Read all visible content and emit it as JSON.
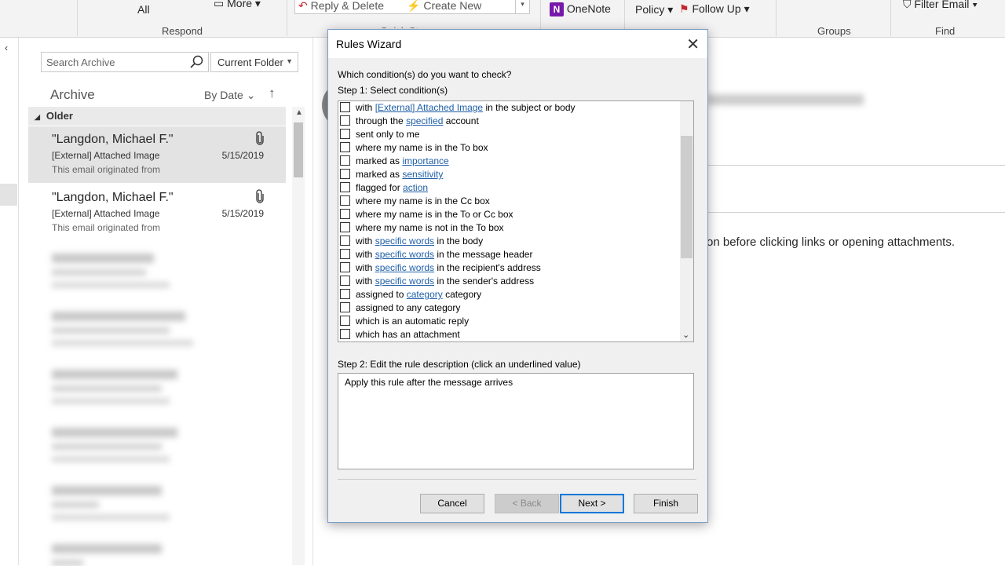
{
  "ribbon": {
    "reply_all": "All",
    "more": "More",
    "respond_group": "Respond",
    "reply_delete": "Reply & Delete",
    "create_new": "Create New",
    "quick_steps_group": "Quick Steps",
    "onenote": "OneNote",
    "policy": "Policy",
    "follow_up": "Follow Up",
    "groups_group": "Groups",
    "filter_email": "Filter Email",
    "find_group": "Find"
  },
  "mail_list": {
    "search_placeholder": "Search Archive",
    "folder_scope": "Current Folder",
    "folder_title": "Archive",
    "sort_label": "By Date",
    "group_header": "Older",
    "items": [
      {
        "from": "\"Langdon, Michael F.\"",
        "subject": "[External] Attached Image",
        "preview": "This email originated from",
        "date": "5/15/2019"
      },
      {
        "from": "\"Langdon, Michael F.\"",
        "subject": "[External] Attached Image",
        "preview": "This email originated from",
        "date": "5/15/2019"
      }
    ]
  },
  "reading_pane": {
    "warning_text": "on before clicking links or opening attachments."
  },
  "dialog": {
    "title": "Rules Wizard",
    "prompt": "Which condition(s) do you want to check?",
    "step1": "Step 1: Select condition(s)",
    "conditions": [
      {
        "pre": "with ",
        "link": "[External] Attached Image",
        "post": " in the subject or body"
      },
      {
        "pre": "through the ",
        "link": "specified",
        "post": " account"
      },
      {
        "pre": "sent only to me",
        "link": "",
        "post": ""
      },
      {
        "pre": "where my name is in the To box",
        "link": "",
        "post": ""
      },
      {
        "pre": "marked as ",
        "link": "importance",
        "post": ""
      },
      {
        "pre": "marked as ",
        "link": "sensitivity",
        "post": ""
      },
      {
        "pre": "flagged for ",
        "link": "action",
        "post": ""
      },
      {
        "pre": "where my name is in the Cc box",
        "link": "",
        "post": ""
      },
      {
        "pre": "where my name is in the To or Cc box",
        "link": "",
        "post": ""
      },
      {
        "pre": "where my name is not in the To box",
        "link": "",
        "post": ""
      },
      {
        "pre": "with ",
        "link": "specific words",
        "post": " in the body"
      },
      {
        "pre": "with ",
        "link": "specific words",
        "post": " in the message header"
      },
      {
        "pre": "with ",
        "link": "specific words",
        "post": " in the recipient's address"
      },
      {
        "pre": "with ",
        "link": "specific words",
        "post": " in the sender's address"
      },
      {
        "pre": "assigned to ",
        "link": "category",
        "post": " category"
      },
      {
        "pre": "assigned to any category",
        "link": "",
        "post": ""
      },
      {
        "pre": "which is an automatic reply",
        "link": "",
        "post": ""
      },
      {
        "pre": "which has an attachment",
        "link": "",
        "post": ""
      }
    ],
    "step2": "Step 2: Edit the rule description (click an underlined value)",
    "description": "Apply this rule after the message arrives",
    "buttons": {
      "cancel": "Cancel",
      "back": "< Back",
      "next": "Next >",
      "finish": "Finish"
    }
  },
  "colors": {
    "link": "#1f5fa8",
    "default_button_border": "#0078d7",
    "onenote": "#7719aa",
    "flag": "#c4262e"
  }
}
